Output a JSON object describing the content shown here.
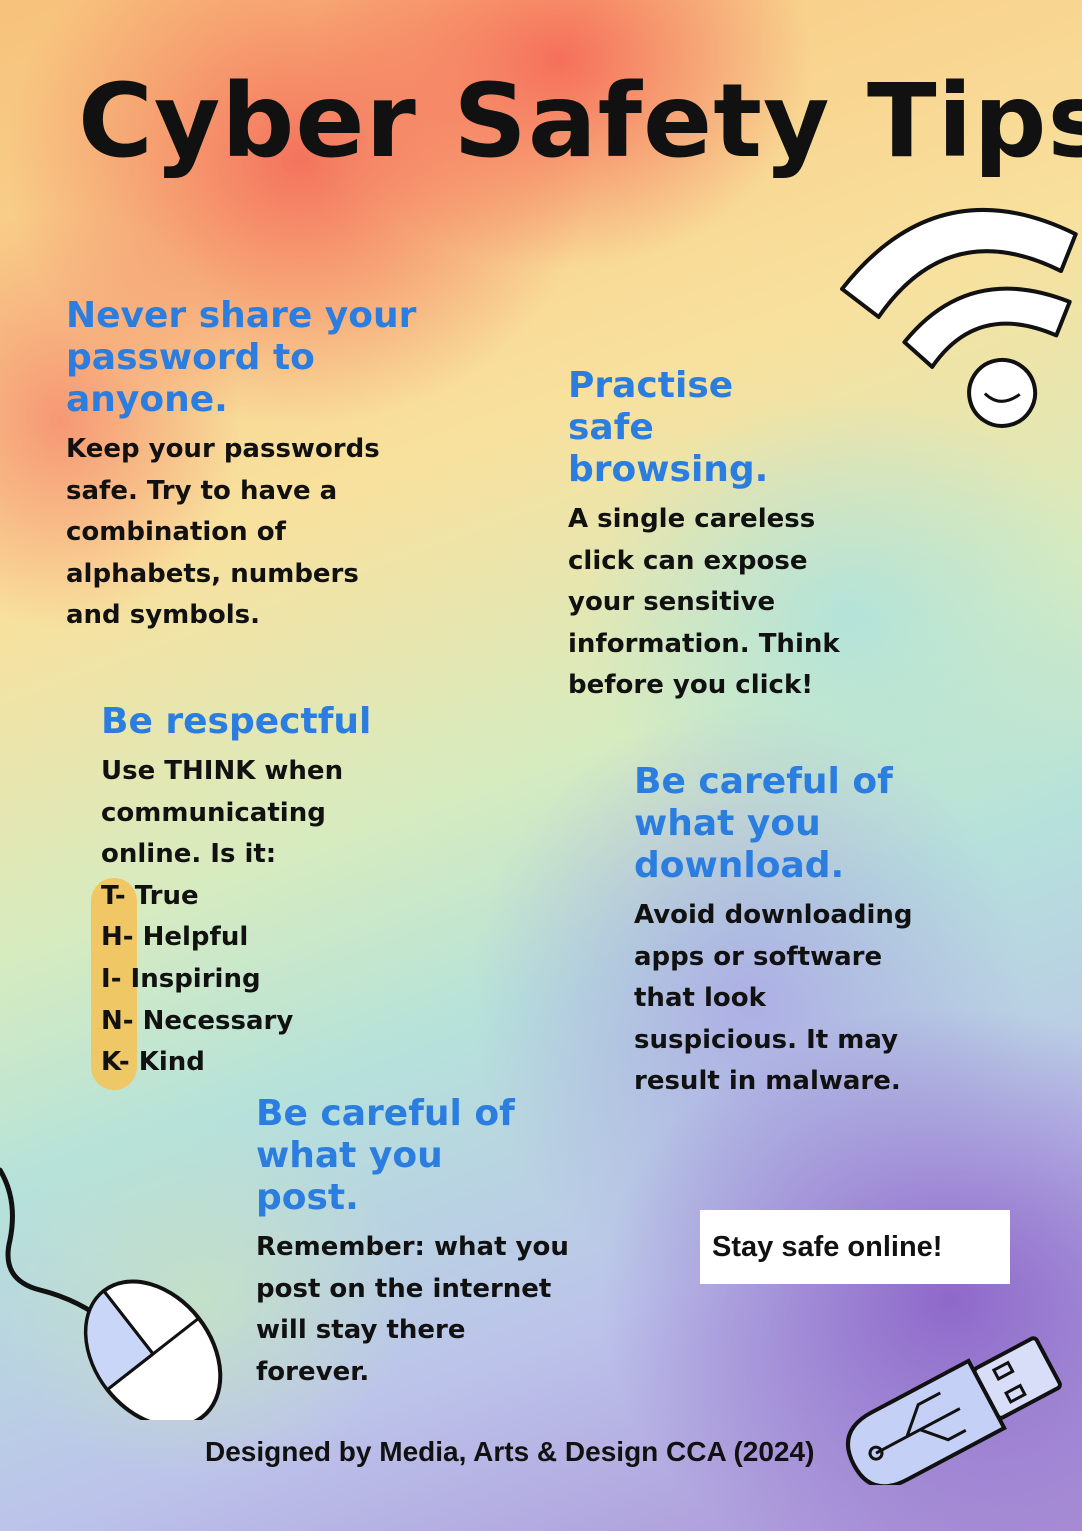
{
  "title": "Cyber Safety Tips",
  "tips": {
    "password": {
      "heading": [
        "Never share your",
        "password to",
        "anyone."
      ],
      "body": [
        "Keep your passwords",
        "safe. Try to have a",
        "combination of",
        "alphabets, numbers",
        "and symbols."
      ]
    },
    "browsing": {
      "heading": [
        "Practise",
        "safe",
        "browsing."
      ],
      "body": [
        "A single careless",
        "click can expose",
        "your sensitive",
        "information. Think",
        "before you click!"
      ]
    },
    "respectful": {
      "heading": "Be respectful",
      "body": [
        "Use THINK when",
        "communicating",
        "online. Is it:"
      ],
      "think": [
        {
          "letter": "T",
          "word": "- True"
        },
        {
          "letter": "H",
          "word": "- Helpful"
        },
        {
          "letter": "I",
          "word": "- Inspiring"
        },
        {
          "letter": "N",
          "word": "- Necessary"
        },
        {
          "letter": "K",
          "word": "- Kind"
        }
      ]
    },
    "download": {
      "heading": [
        "Be careful of",
        "what you",
        "download."
      ],
      "body": [
        "Avoid downloading",
        "apps or software",
        "that look",
        "suspicious. It may",
        "result in malware."
      ]
    },
    "post": {
      "heading": [
        "Be careful of",
        "what you",
        "post."
      ],
      "body": [
        "Remember: what you",
        "post on the internet",
        "will stay there",
        "forever."
      ]
    }
  },
  "closing": "Stay safe online!",
  "credit": "Designed by Media, Arts & Design CCA (2024)",
  "icons": [
    "wifi-icon",
    "computer-mouse-icon",
    "usb-drive-icon"
  ],
  "colors": {
    "heading": "#2b7de0",
    "text": "#111111",
    "highlight": "#f3c35a"
  }
}
